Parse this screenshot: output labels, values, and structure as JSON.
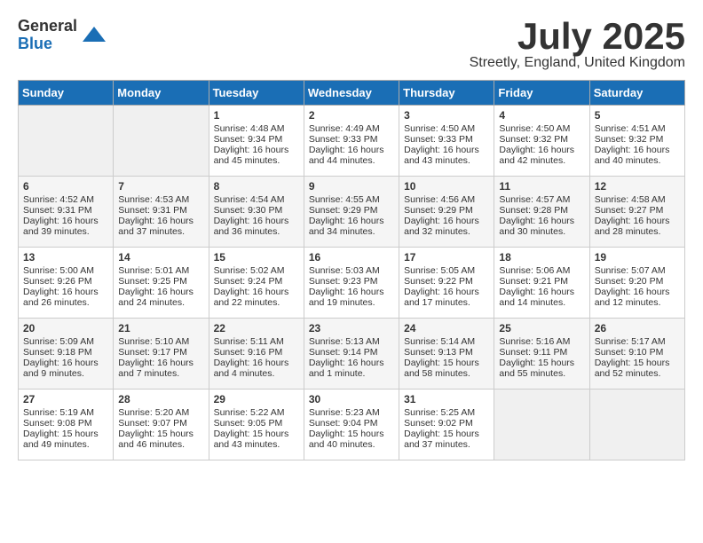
{
  "logo": {
    "general": "General",
    "blue": "Blue"
  },
  "title": "July 2025",
  "location": "Streetly, England, United Kingdom",
  "days_of_week": [
    "Sunday",
    "Monday",
    "Tuesday",
    "Wednesday",
    "Thursday",
    "Friday",
    "Saturday"
  ],
  "weeks": [
    [
      {
        "day": "",
        "empty": true
      },
      {
        "day": "",
        "empty": true
      },
      {
        "day": "1",
        "sunrise": "Sunrise: 4:48 AM",
        "sunset": "Sunset: 9:34 PM",
        "daylight": "Daylight: 16 hours and 45 minutes."
      },
      {
        "day": "2",
        "sunrise": "Sunrise: 4:49 AM",
        "sunset": "Sunset: 9:33 PM",
        "daylight": "Daylight: 16 hours and 44 minutes."
      },
      {
        "day": "3",
        "sunrise": "Sunrise: 4:50 AM",
        "sunset": "Sunset: 9:33 PM",
        "daylight": "Daylight: 16 hours and 43 minutes."
      },
      {
        "day": "4",
        "sunrise": "Sunrise: 4:50 AM",
        "sunset": "Sunset: 9:32 PM",
        "daylight": "Daylight: 16 hours and 42 minutes."
      },
      {
        "day": "5",
        "sunrise": "Sunrise: 4:51 AM",
        "sunset": "Sunset: 9:32 PM",
        "daylight": "Daylight: 16 hours and 40 minutes."
      }
    ],
    [
      {
        "day": "6",
        "sunrise": "Sunrise: 4:52 AM",
        "sunset": "Sunset: 9:31 PM",
        "daylight": "Daylight: 16 hours and 39 minutes."
      },
      {
        "day": "7",
        "sunrise": "Sunrise: 4:53 AM",
        "sunset": "Sunset: 9:31 PM",
        "daylight": "Daylight: 16 hours and 37 minutes."
      },
      {
        "day": "8",
        "sunrise": "Sunrise: 4:54 AM",
        "sunset": "Sunset: 9:30 PM",
        "daylight": "Daylight: 16 hours and 36 minutes."
      },
      {
        "day": "9",
        "sunrise": "Sunrise: 4:55 AM",
        "sunset": "Sunset: 9:29 PM",
        "daylight": "Daylight: 16 hours and 34 minutes."
      },
      {
        "day": "10",
        "sunrise": "Sunrise: 4:56 AM",
        "sunset": "Sunset: 9:29 PM",
        "daylight": "Daylight: 16 hours and 32 minutes."
      },
      {
        "day": "11",
        "sunrise": "Sunrise: 4:57 AM",
        "sunset": "Sunset: 9:28 PM",
        "daylight": "Daylight: 16 hours and 30 minutes."
      },
      {
        "day": "12",
        "sunrise": "Sunrise: 4:58 AM",
        "sunset": "Sunset: 9:27 PM",
        "daylight": "Daylight: 16 hours and 28 minutes."
      }
    ],
    [
      {
        "day": "13",
        "sunrise": "Sunrise: 5:00 AM",
        "sunset": "Sunset: 9:26 PM",
        "daylight": "Daylight: 16 hours and 26 minutes."
      },
      {
        "day": "14",
        "sunrise": "Sunrise: 5:01 AM",
        "sunset": "Sunset: 9:25 PM",
        "daylight": "Daylight: 16 hours and 24 minutes."
      },
      {
        "day": "15",
        "sunrise": "Sunrise: 5:02 AM",
        "sunset": "Sunset: 9:24 PM",
        "daylight": "Daylight: 16 hours and 22 minutes."
      },
      {
        "day": "16",
        "sunrise": "Sunrise: 5:03 AM",
        "sunset": "Sunset: 9:23 PM",
        "daylight": "Daylight: 16 hours and 19 minutes."
      },
      {
        "day": "17",
        "sunrise": "Sunrise: 5:05 AM",
        "sunset": "Sunset: 9:22 PM",
        "daylight": "Daylight: 16 hours and 17 minutes."
      },
      {
        "day": "18",
        "sunrise": "Sunrise: 5:06 AM",
        "sunset": "Sunset: 9:21 PM",
        "daylight": "Daylight: 16 hours and 14 minutes."
      },
      {
        "day": "19",
        "sunrise": "Sunrise: 5:07 AM",
        "sunset": "Sunset: 9:20 PM",
        "daylight": "Daylight: 16 hours and 12 minutes."
      }
    ],
    [
      {
        "day": "20",
        "sunrise": "Sunrise: 5:09 AM",
        "sunset": "Sunset: 9:18 PM",
        "daylight": "Daylight: 16 hours and 9 minutes."
      },
      {
        "day": "21",
        "sunrise": "Sunrise: 5:10 AM",
        "sunset": "Sunset: 9:17 PM",
        "daylight": "Daylight: 16 hours and 7 minutes."
      },
      {
        "day": "22",
        "sunrise": "Sunrise: 5:11 AM",
        "sunset": "Sunset: 9:16 PM",
        "daylight": "Daylight: 16 hours and 4 minutes."
      },
      {
        "day": "23",
        "sunrise": "Sunrise: 5:13 AM",
        "sunset": "Sunset: 9:14 PM",
        "daylight": "Daylight: 16 hours and 1 minute."
      },
      {
        "day": "24",
        "sunrise": "Sunrise: 5:14 AM",
        "sunset": "Sunset: 9:13 PM",
        "daylight": "Daylight: 15 hours and 58 minutes."
      },
      {
        "day": "25",
        "sunrise": "Sunrise: 5:16 AM",
        "sunset": "Sunset: 9:11 PM",
        "daylight": "Daylight: 15 hours and 55 minutes."
      },
      {
        "day": "26",
        "sunrise": "Sunrise: 5:17 AM",
        "sunset": "Sunset: 9:10 PM",
        "daylight": "Daylight: 15 hours and 52 minutes."
      }
    ],
    [
      {
        "day": "27",
        "sunrise": "Sunrise: 5:19 AM",
        "sunset": "Sunset: 9:08 PM",
        "daylight": "Daylight: 15 hours and 49 minutes."
      },
      {
        "day": "28",
        "sunrise": "Sunrise: 5:20 AM",
        "sunset": "Sunset: 9:07 PM",
        "daylight": "Daylight: 15 hours and 46 minutes."
      },
      {
        "day": "29",
        "sunrise": "Sunrise: 5:22 AM",
        "sunset": "Sunset: 9:05 PM",
        "daylight": "Daylight: 15 hours and 43 minutes."
      },
      {
        "day": "30",
        "sunrise": "Sunrise: 5:23 AM",
        "sunset": "Sunset: 9:04 PM",
        "daylight": "Daylight: 15 hours and 40 minutes."
      },
      {
        "day": "31",
        "sunrise": "Sunrise: 5:25 AM",
        "sunset": "Sunset: 9:02 PM",
        "daylight": "Daylight: 15 hours and 37 minutes."
      },
      {
        "day": "",
        "empty": true
      },
      {
        "day": "",
        "empty": true
      }
    ]
  ]
}
